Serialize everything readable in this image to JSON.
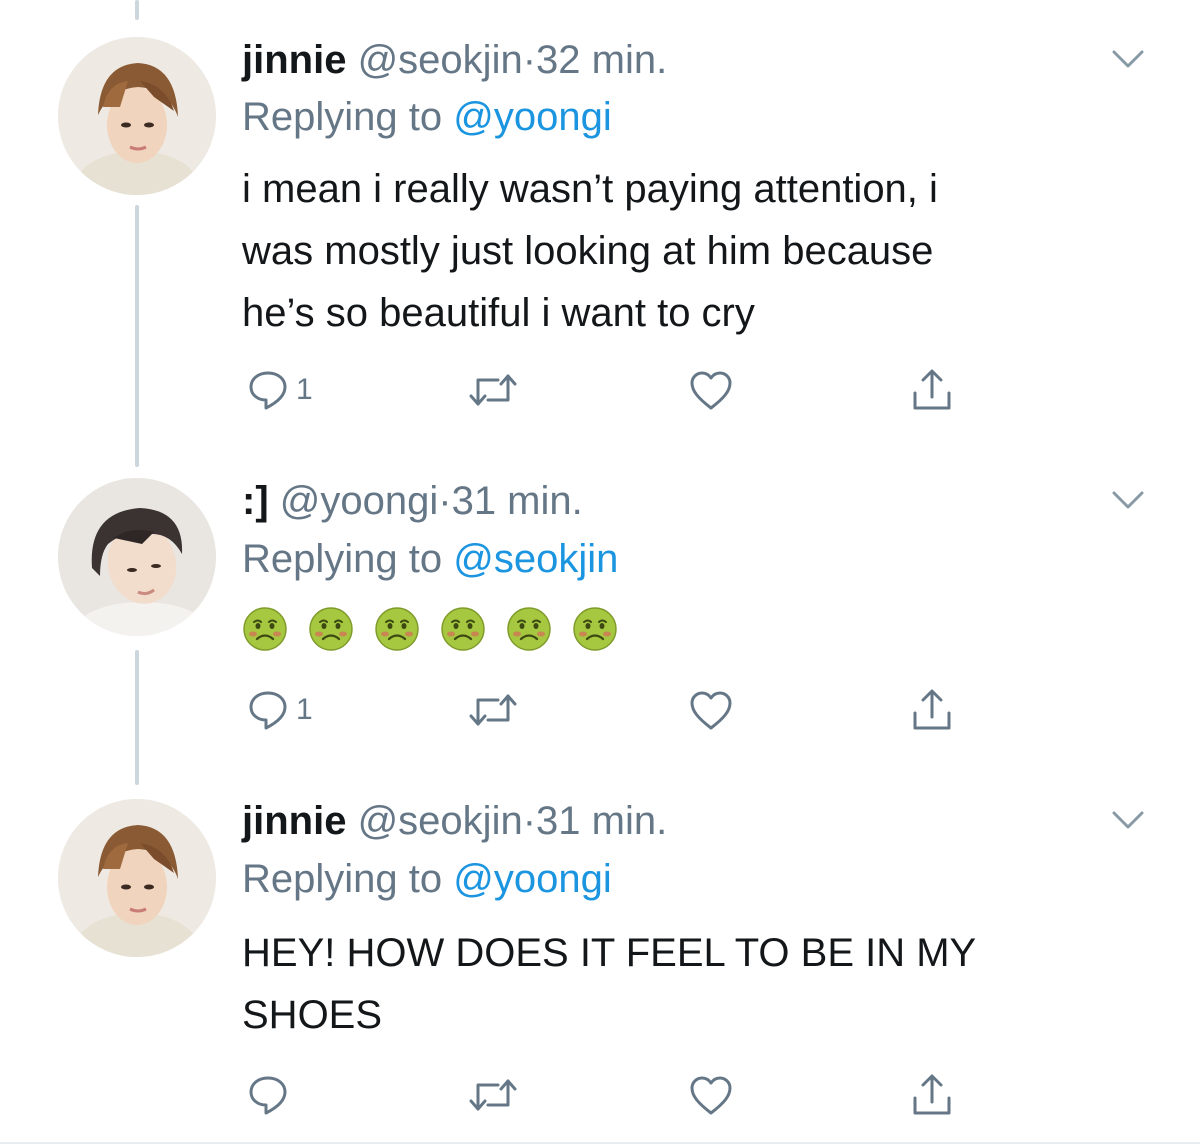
{
  "tweets": [
    {
      "name": "jinnie",
      "handle": "@seokjin",
      "separator": "·",
      "time": "32 min.",
      "replying_prefix": "Replying to",
      "replying_to": "@yoongi",
      "text_lines": [
        "i mean i really wasn’t paying attention, i",
        "was mostly just looking at him because",
        "he’s so beautiful i want to cry"
      ],
      "reply_count": "1"
    },
    {
      "name": ":]",
      "handle": "@yoongi",
      "separator": "·",
      "time": "31 min.",
      "replying_prefix": "Replying to",
      "replying_to": "@seokjin",
      "emoji_count": 6,
      "emoji_name": "nauseated-face",
      "reply_count": "1"
    },
    {
      "name": "jinnie",
      "handle": "@seokjin",
      "separator": "·",
      "time": "31 min.",
      "replying_prefix": "Replying to",
      "replying_to": "@yoongi",
      "text_lines": [
        "HEY! HOW DOES IT FEEL TO BE IN MY",
        "SHOES"
      ],
      "reply_count": ""
    }
  ],
  "icons": {
    "reply": "reply-icon",
    "retweet": "retweet-icon",
    "like": "heart-icon",
    "share": "share-icon",
    "menu": "chevron-down-icon"
  },
  "colors": {
    "text": "#14171a",
    "secondary": "#657786",
    "link": "#1b95e0",
    "thread_line": "#ccd6dd",
    "emoji_green": "#a6c740"
  }
}
